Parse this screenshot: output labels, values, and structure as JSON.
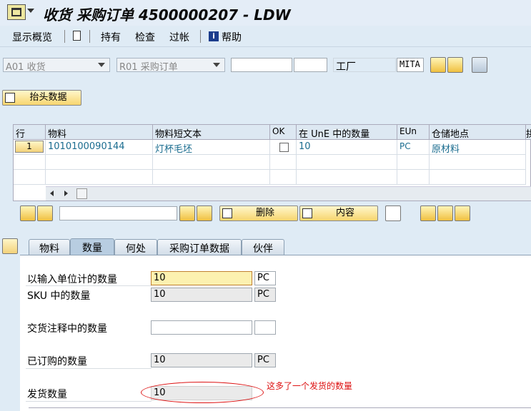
{
  "window": {
    "title": "收货 采购订单 4500000207 - LDW"
  },
  "menu": {
    "display_overview": "显示概览",
    "hold": "持有",
    "check": "检查",
    "post": "过帐",
    "help": "帮助"
  },
  "header_row": {
    "transaction": "A01 收货",
    "reference": "R01 采购订单",
    "po_number": "",
    "po_item": "",
    "plant_label": "工厂",
    "plant_value": "MITA"
  },
  "header_data_button": "抬头数据",
  "grid": {
    "columns": [
      "行",
      "物料",
      "物料短文本",
      "OK",
      "在 UnE 中的数量",
      "EUn",
      "仓储地点",
      "拱"
    ],
    "rows": [
      {
        "line": "1",
        "material": "1010100090144",
        "text": "灯杯毛坯",
        "ok": false,
        "qty": "10",
        "eun": "PC",
        "sloc": "原材料"
      }
    ]
  },
  "item_toolbar": {
    "search_value": "",
    "delete_label": "删除",
    "content_label": "内容"
  },
  "tabs": [
    "物料",
    "数量",
    "何处",
    "采购订单数据",
    "伙伴"
  ],
  "active_tab": "数量",
  "quantity": {
    "entry_label": "以输入单位计的数量",
    "entry_value": "10",
    "entry_unit": "PC",
    "sku_label": "SKU 中的数量",
    "sku_value": "10",
    "sku_unit": "PC",
    "delivery_note_label": "交货注释中的数量",
    "delivery_note_value": "",
    "delivery_note_unit": "",
    "ordered_label": "已订购的数量",
    "ordered_value": "10",
    "ordered_unit": "PC",
    "shipped_label": "发货数量",
    "shipped_value": "10"
  },
  "annotation": {
    "text": "这多了一个发货的数量",
    "color": "#dd1111"
  }
}
